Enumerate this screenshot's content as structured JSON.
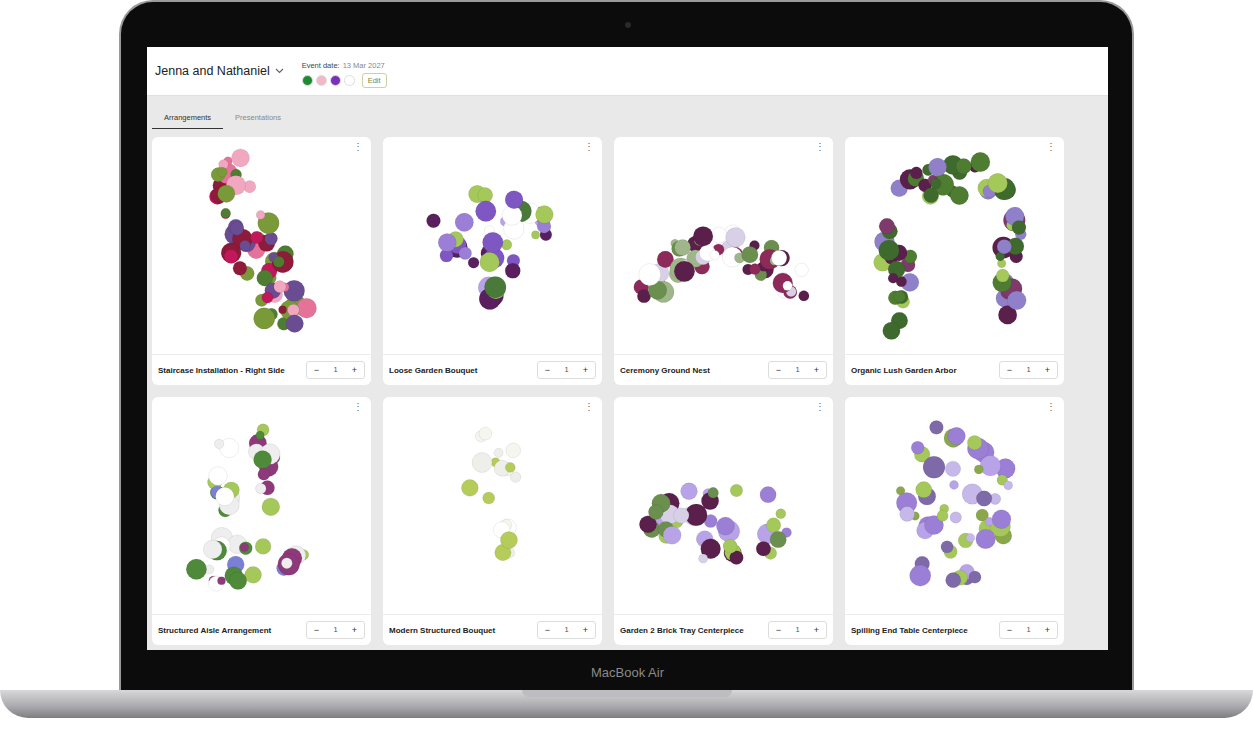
{
  "header": {
    "client": "Jenna and Nathaniel",
    "event_label": "Event date:",
    "event_date": "13 Mar 2027",
    "palette": [
      {
        "color": "#1e8c2e"
      },
      {
        "color": "#f2b8c6"
      },
      {
        "color": "#7b2fbf"
      },
      {
        "color": "#ffffff"
      }
    ],
    "edit_button": "Edit"
  },
  "tabs": [
    {
      "label": "Arrangements",
      "selected": true
    },
    {
      "label": "Presentations",
      "selected": false
    }
  ],
  "cards": [
    {
      "name": "Staircase Installation - Right Side",
      "quantity": "1",
      "kind": "cascade"
    },
    {
      "name": "Loose Garden Bouquet",
      "quantity": "1",
      "kind": "bouquet"
    },
    {
      "name": "Ceremony Ground Nest",
      "quantity": "1",
      "kind": "arc"
    },
    {
      "name": "Organic Lush Garden Arbor",
      "quantity": "1",
      "kind": "arch"
    },
    {
      "name": "Structured Aisle Arrangement",
      "quantity": "1",
      "kind": "aisle"
    },
    {
      "name": "Modern Structured Bouquet",
      "quantity": "1",
      "kind": "orchid"
    },
    {
      "name": "Garden 2 Brick Tray Centerpiece",
      "quantity": "1",
      "kind": "low"
    },
    {
      "name": "Spilling End Table Centerpiece",
      "quantity": "1",
      "kind": "spill"
    }
  ],
  "card_controls": {
    "menu": "⋮",
    "minus": "−",
    "plus": "+"
  },
  "device_label": "MacBook Air"
}
